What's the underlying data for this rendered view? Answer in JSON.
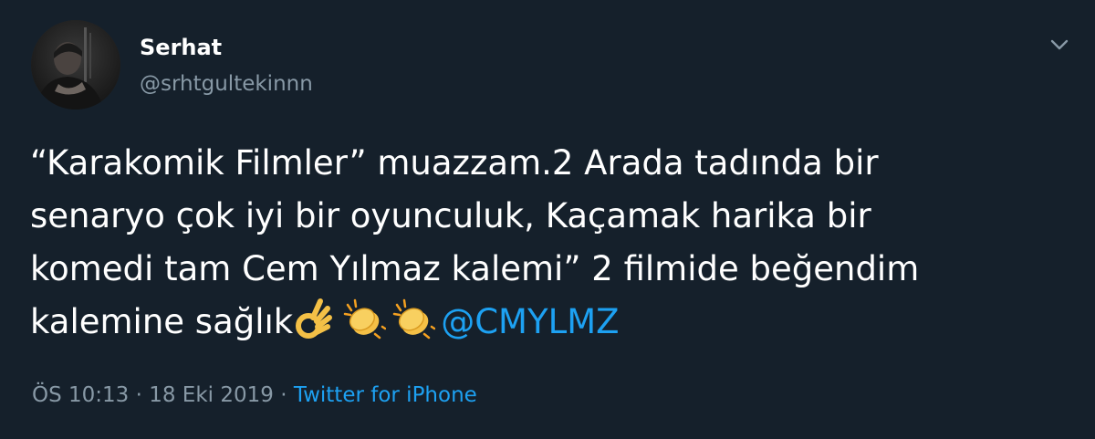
{
  "author": {
    "name": "Serhat",
    "handle": "@srhtgultekinnn"
  },
  "menu": {
    "icon": "chevron-down-icon"
  },
  "tweet": {
    "line1": "“Karakomik Filmler” muazzam.2 Arada tadında bir",
    "line2": "senaryo çok iyi bir oyunculuk, Kaçamak harika bir",
    "line3": "komedi tam Cem Yılmaz kalemi” 2 filmide beğendim",
    "line4_text": "kalemine sağlık",
    "emojis": [
      "ok-hand-emoji",
      "clapping-hands-emoji",
      "clapping-hands-emoji"
    ],
    "mention": "@CMYLMZ"
  },
  "meta": {
    "time": "ÖS 10:13",
    "separator1": " · ",
    "date": "18 Eki 2019",
    "separator2": " · ",
    "source": "Twitter for iPhone"
  },
  "colors": {
    "background": "#15202b",
    "text": "#ffffff",
    "secondary": "#8899a6",
    "accent": "#1da1f2"
  }
}
